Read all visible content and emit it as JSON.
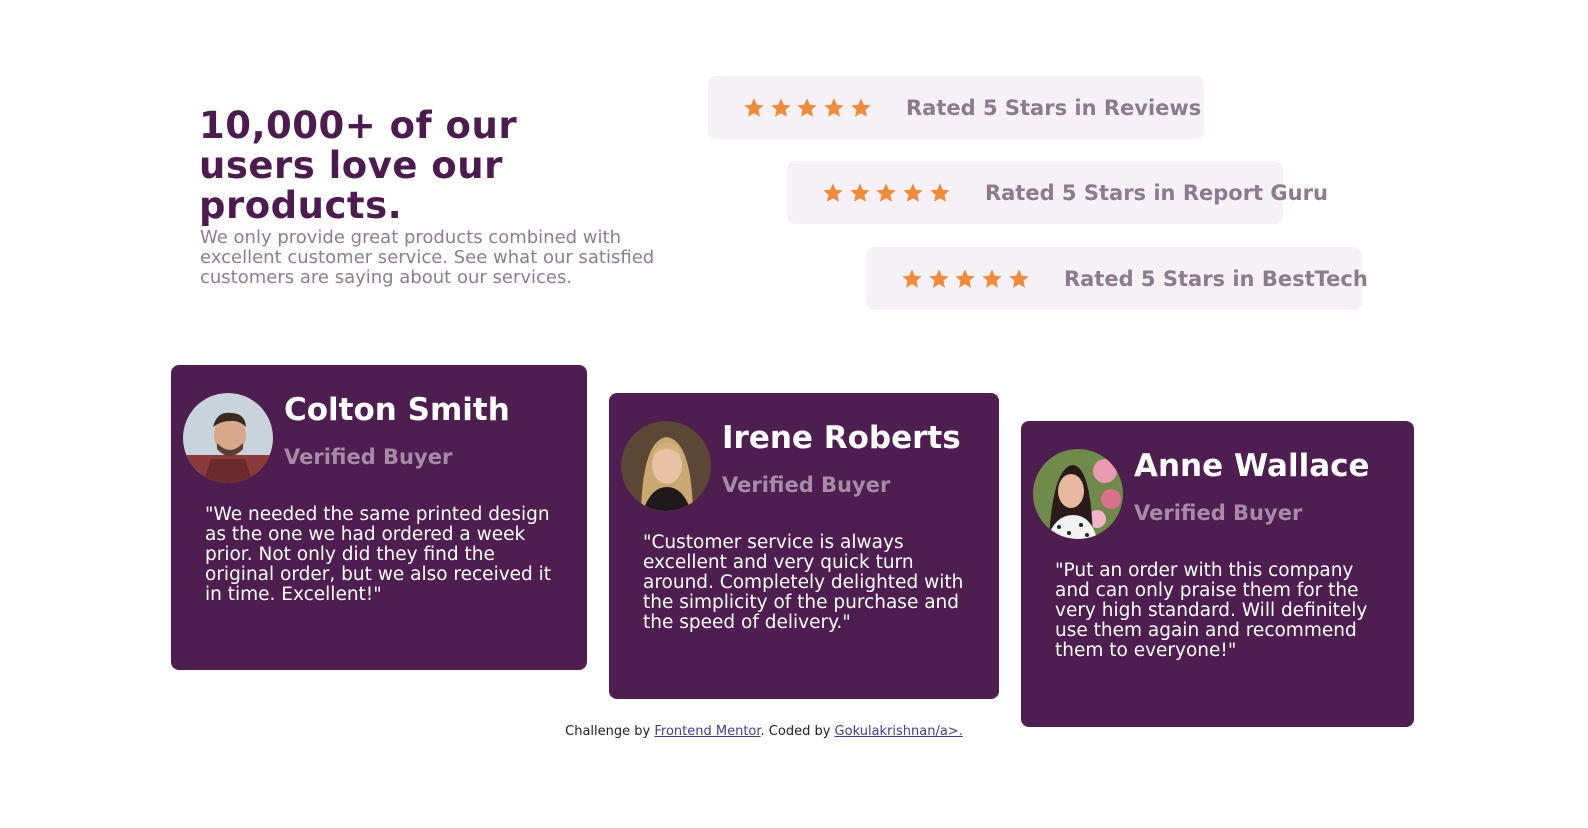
{
  "hero": {
    "headline": "10,000+ of our users love our products.",
    "intro": "We only provide great products combined with excellent customer service. See what our satisfied customers are saying about our services."
  },
  "ratings": [
    {
      "stars": 5,
      "label": "Rated 5 Stars in Reviews"
    },
    {
      "stars": 5,
      "label": "Rated 5 Stars in Report Guru"
    },
    {
      "stars": 5,
      "label": "Rated 5 Stars in BestTech"
    }
  ],
  "testimonials": [
    {
      "name": "Colton Smith",
      "badge": "Verified Buyer",
      "quote": "\"We needed the same printed design as the one we had ordered a week prior. Not only did they find the original order, but we also received it in time. Excellent!\""
    },
    {
      "name": "Irene Roberts",
      "badge": "Verified Buyer",
      "quote": "\"Customer service is always excellent and very quick turn around. Completely delighted with the simplicity of the purchase and the speed of delivery.\""
    },
    {
      "name": "Anne Wallace",
      "badge": "Verified Buyer",
      "quote": "\"Put an order with this company and can only praise them for the very high standard. Will definitely use them again and recommend them to everyone!\""
    }
  ],
  "footer": {
    "prefix": "Challenge by ",
    "link1": "Frontend Mentor",
    "middle": ". Coded by ",
    "link2": "Gokulakrishnan/a>."
  },
  "colors": {
    "accent": "#4f1e50",
    "star": "#ee8c3c",
    "rating_bg": "#f6f1f6"
  }
}
